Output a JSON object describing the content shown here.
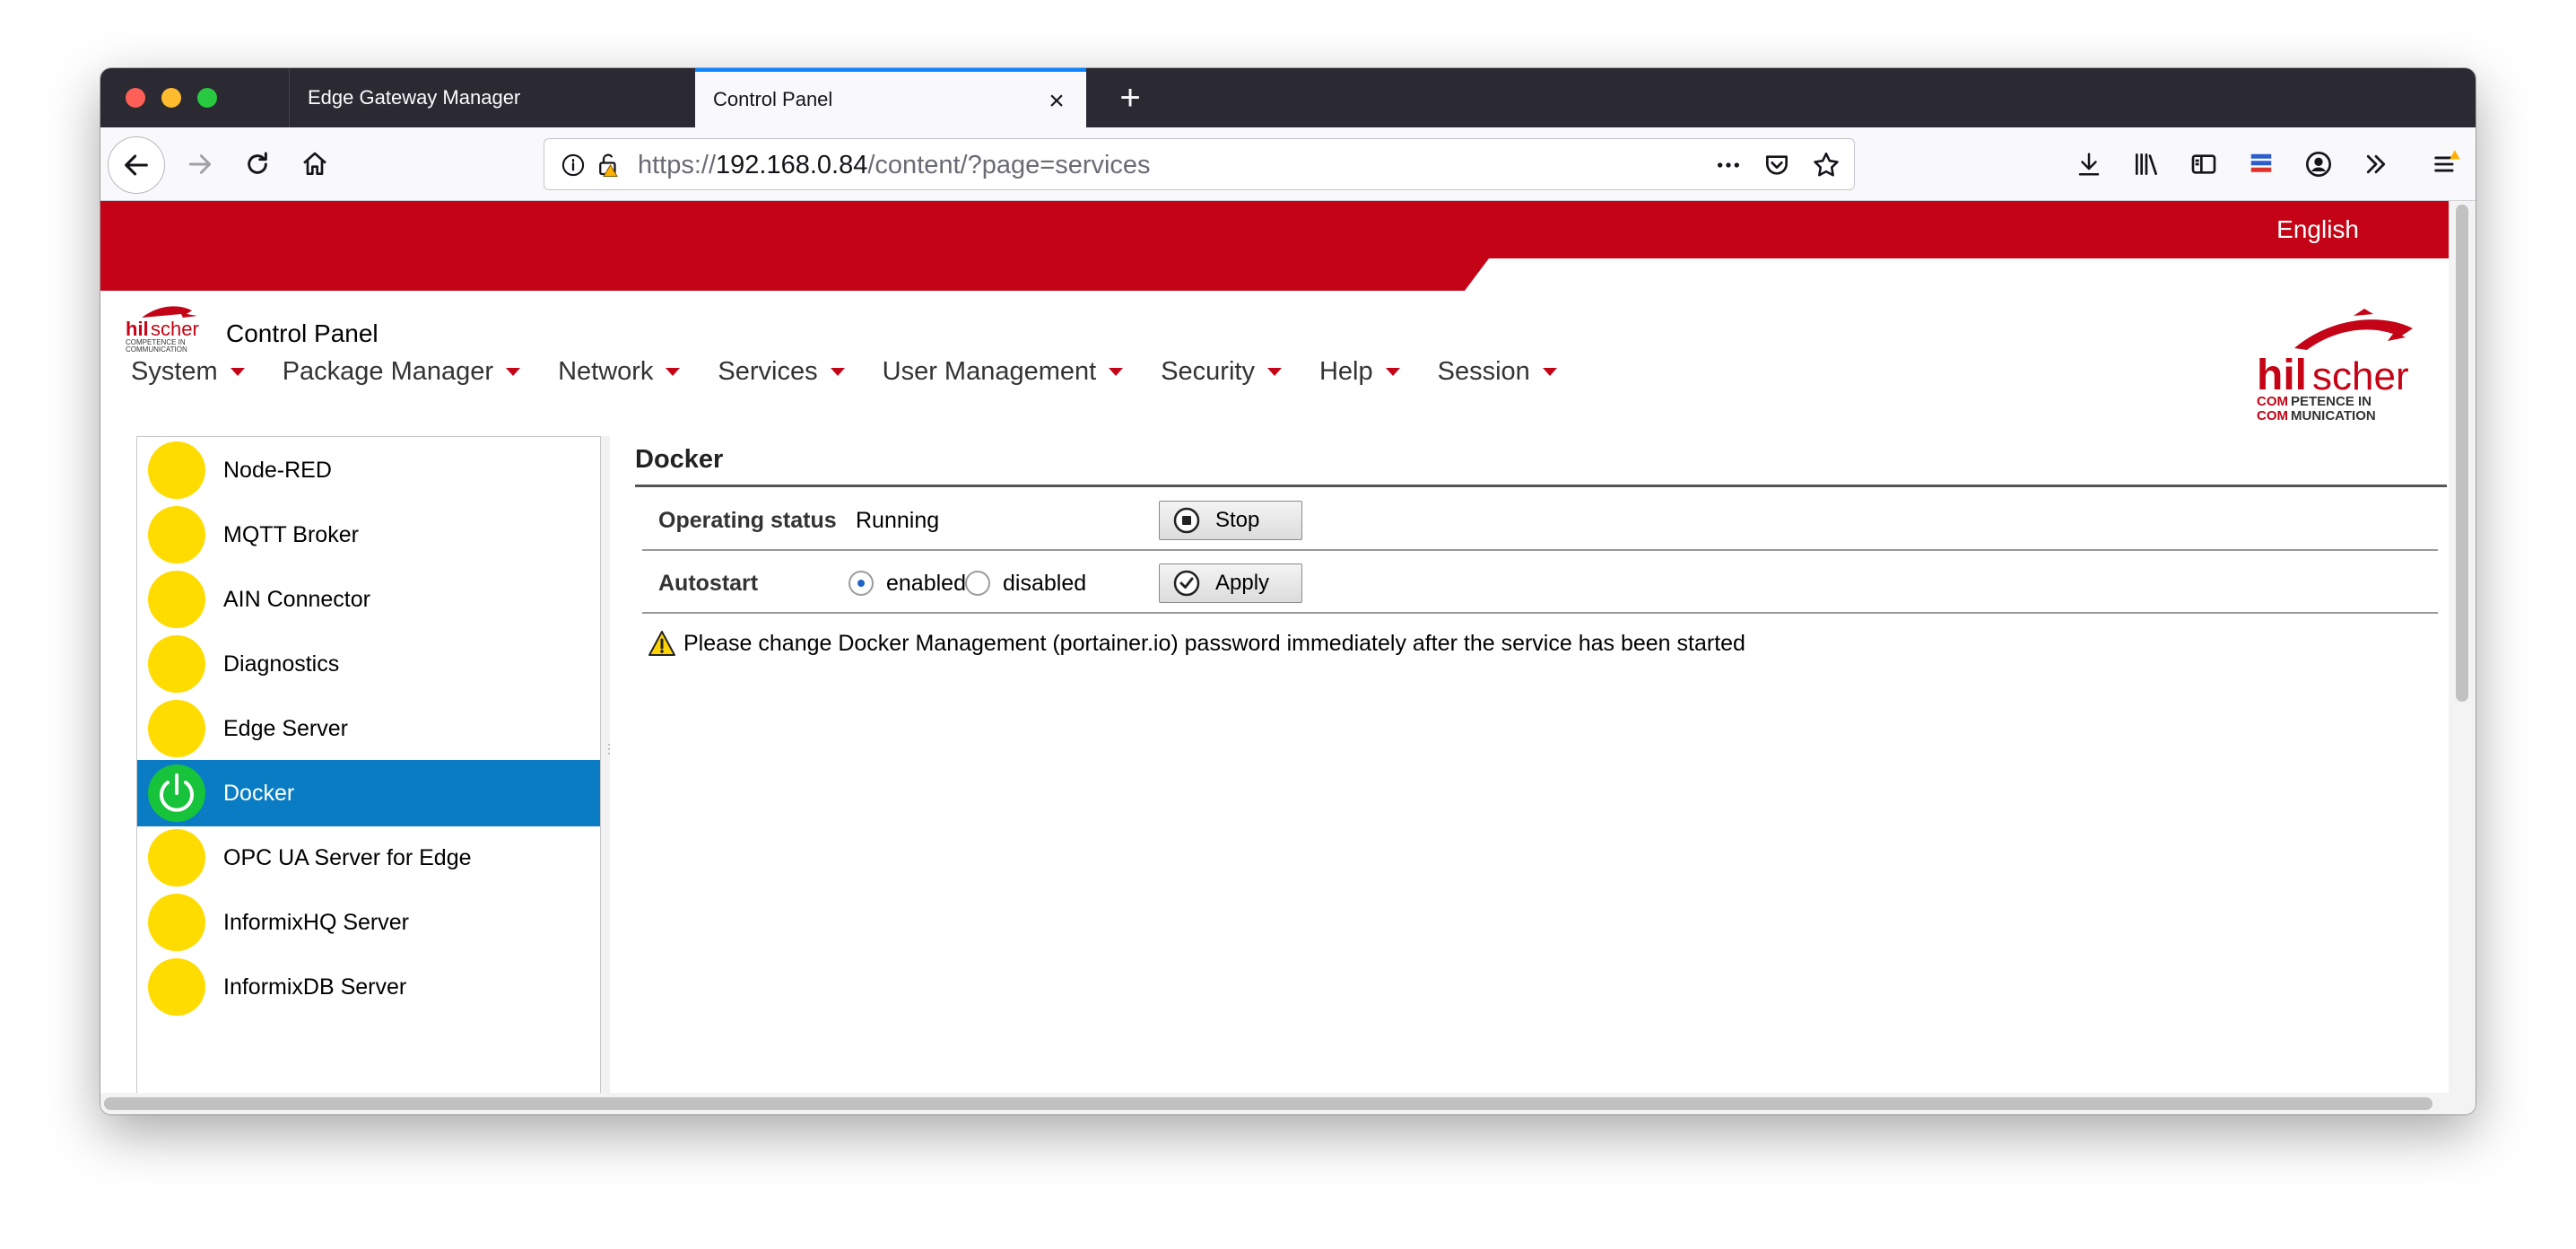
{
  "browser": {
    "tabs": [
      {
        "title": "Edge Gateway Manager",
        "active": false
      },
      {
        "title": "Control Panel",
        "active": true
      }
    ],
    "url": {
      "scheme": "https://",
      "host": "192.168.0.84",
      "path": "/content/?page=services"
    },
    "accent_color": "#0a84ff"
  },
  "header": {
    "language": "English",
    "app_title": "Control Panel",
    "brand_color": "#c40416",
    "logo_text": "hilscher",
    "logo_tagline": "COMPETENCE IN COMMUNICATION"
  },
  "menu": [
    {
      "label": "System"
    },
    {
      "label": "Package Manager"
    },
    {
      "label": "Network"
    },
    {
      "label": "Services"
    },
    {
      "label": "User Management"
    },
    {
      "label": "Security"
    },
    {
      "label": "Help"
    },
    {
      "label": "Session"
    }
  ],
  "services": [
    {
      "name": "Node-RED",
      "active": false
    },
    {
      "name": "MQTT Broker",
      "active": false
    },
    {
      "name": "AIN Connector",
      "active": false
    },
    {
      "name": "Diagnostics",
      "active": false
    },
    {
      "name": "Edge Server",
      "active": false
    },
    {
      "name": "Docker",
      "active": true
    },
    {
      "name": "OPC UA Server for Edge",
      "active": false
    },
    {
      "name": "InformixHQ Server",
      "active": false
    },
    {
      "name": "InformixDB Server",
      "active": false
    }
  ],
  "detail": {
    "title": "Docker",
    "status_label": "Operating status",
    "status_value": "Running",
    "stop_button": "Stop",
    "autostart_label": "Autostart",
    "radio_enabled": "enabled",
    "radio_disabled": "disabled",
    "autostart_selected": "enabled",
    "apply_button": "Apply",
    "warning": "Please change Docker Management (portainer.io) password immediately after the service has been started"
  }
}
